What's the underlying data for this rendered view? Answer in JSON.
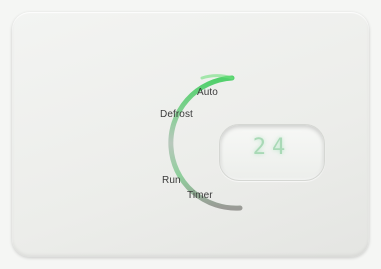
{
  "modes": {
    "auto": "Auto",
    "defrost": "Defrost",
    "run": "Run",
    "timer": "Timer"
  },
  "display": {
    "value": "24"
  },
  "colors": {
    "ring_green": "#4fd06a",
    "ring_gray": "#9a9a96",
    "digit_green": "#a9d9b6"
  }
}
